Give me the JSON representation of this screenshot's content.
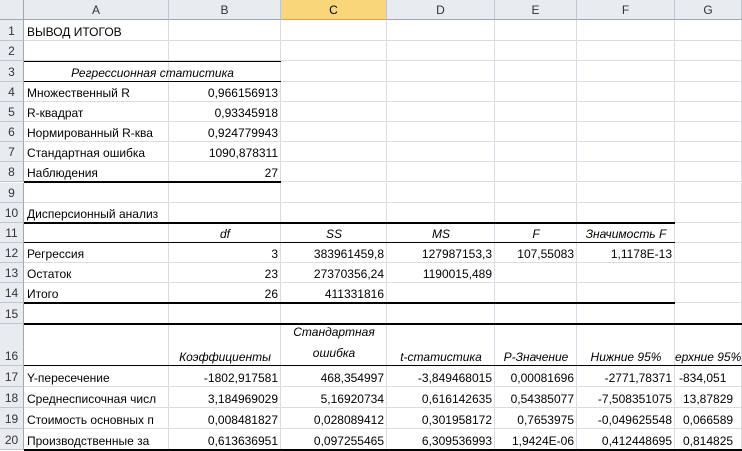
{
  "columns": [
    "A",
    "B",
    "C",
    "D",
    "E",
    "F",
    "G"
  ],
  "selected_column": "C",
  "rows": [
    "1",
    "2",
    "3",
    "4",
    "5",
    "6",
    "7",
    "8",
    "9",
    "10",
    "11",
    "12",
    "13",
    "14",
    "15",
    "16",
    "17",
    "18",
    "19",
    "20"
  ],
  "sheet": {
    "title": "ВЫВОД ИТОГОВ",
    "regression_stats": {
      "header": "Регрессионная статистика",
      "items": [
        {
          "label": "Множественный R",
          "value": "0,966156913"
        },
        {
          "label": "R-квадрат",
          "value": "0,93345918"
        },
        {
          "label": "Нормированный R-ква",
          "value": "0,924779943"
        },
        {
          "label": "Стандартная ошибка",
          "value": "1090,878311"
        },
        {
          "label": "Наблюдения",
          "value": "27"
        }
      ]
    },
    "anova": {
      "title": "Дисперсионный анализ",
      "headers": [
        "df",
        "SS",
        "MS",
        "F",
        "Значимость F"
      ],
      "rows": [
        {
          "label": "Регрессия",
          "df": "3",
          "ss": "383961459,8",
          "ms": "127987153,3",
          "f": "107,55083",
          "sig": "1,1178E-13"
        },
        {
          "label": "Остаток",
          "df": "23",
          "ss": "27370356,24",
          "ms": "1190015,489",
          "f": "",
          "sig": ""
        },
        {
          "label": "Итого",
          "df": "26",
          "ss": "411331816",
          "ms": "",
          "f": "",
          "sig": ""
        }
      ]
    },
    "coefficients": {
      "headers": {
        "coef": "Коэффициенты",
        "se_line1": "Стандартная",
        "se_line2": "ошибка",
        "t": "t-статистика",
        "p": "P-Значение",
        "lower": "Нижние 95%",
        "upper": "ерхние 95%"
      },
      "rows": [
        {
          "label": "Y-пересечение",
          "coef": "-1802,917581",
          "se": "468,354997",
          "t": "-3,849468015",
          "p": "0,00081696",
          "lower": "-2771,78371",
          "upper": "-834,051"
        },
        {
          "label": "Среднесписочная числ",
          "coef": "3,184969029",
          "se": "5,16920734",
          "t": "0,616142635",
          "p": "0,54385077",
          "lower": "-7,508351075",
          "upper": "13,87829"
        },
        {
          "label": "Стоимость основных п",
          "coef": "0,008481827",
          "se": "0,028089412",
          "t": "0,301958172",
          "p": "0,7653975",
          "lower": "-0,049625548",
          "upper": "0,066589"
        },
        {
          "label": "Производственные за",
          "coef": "0,613636951",
          "se": "0,097255465",
          "t": "6,309536993",
          "p": "1,9424E-06",
          "lower": "0,412448695",
          "upper": "0,814825"
        }
      ]
    }
  }
}
